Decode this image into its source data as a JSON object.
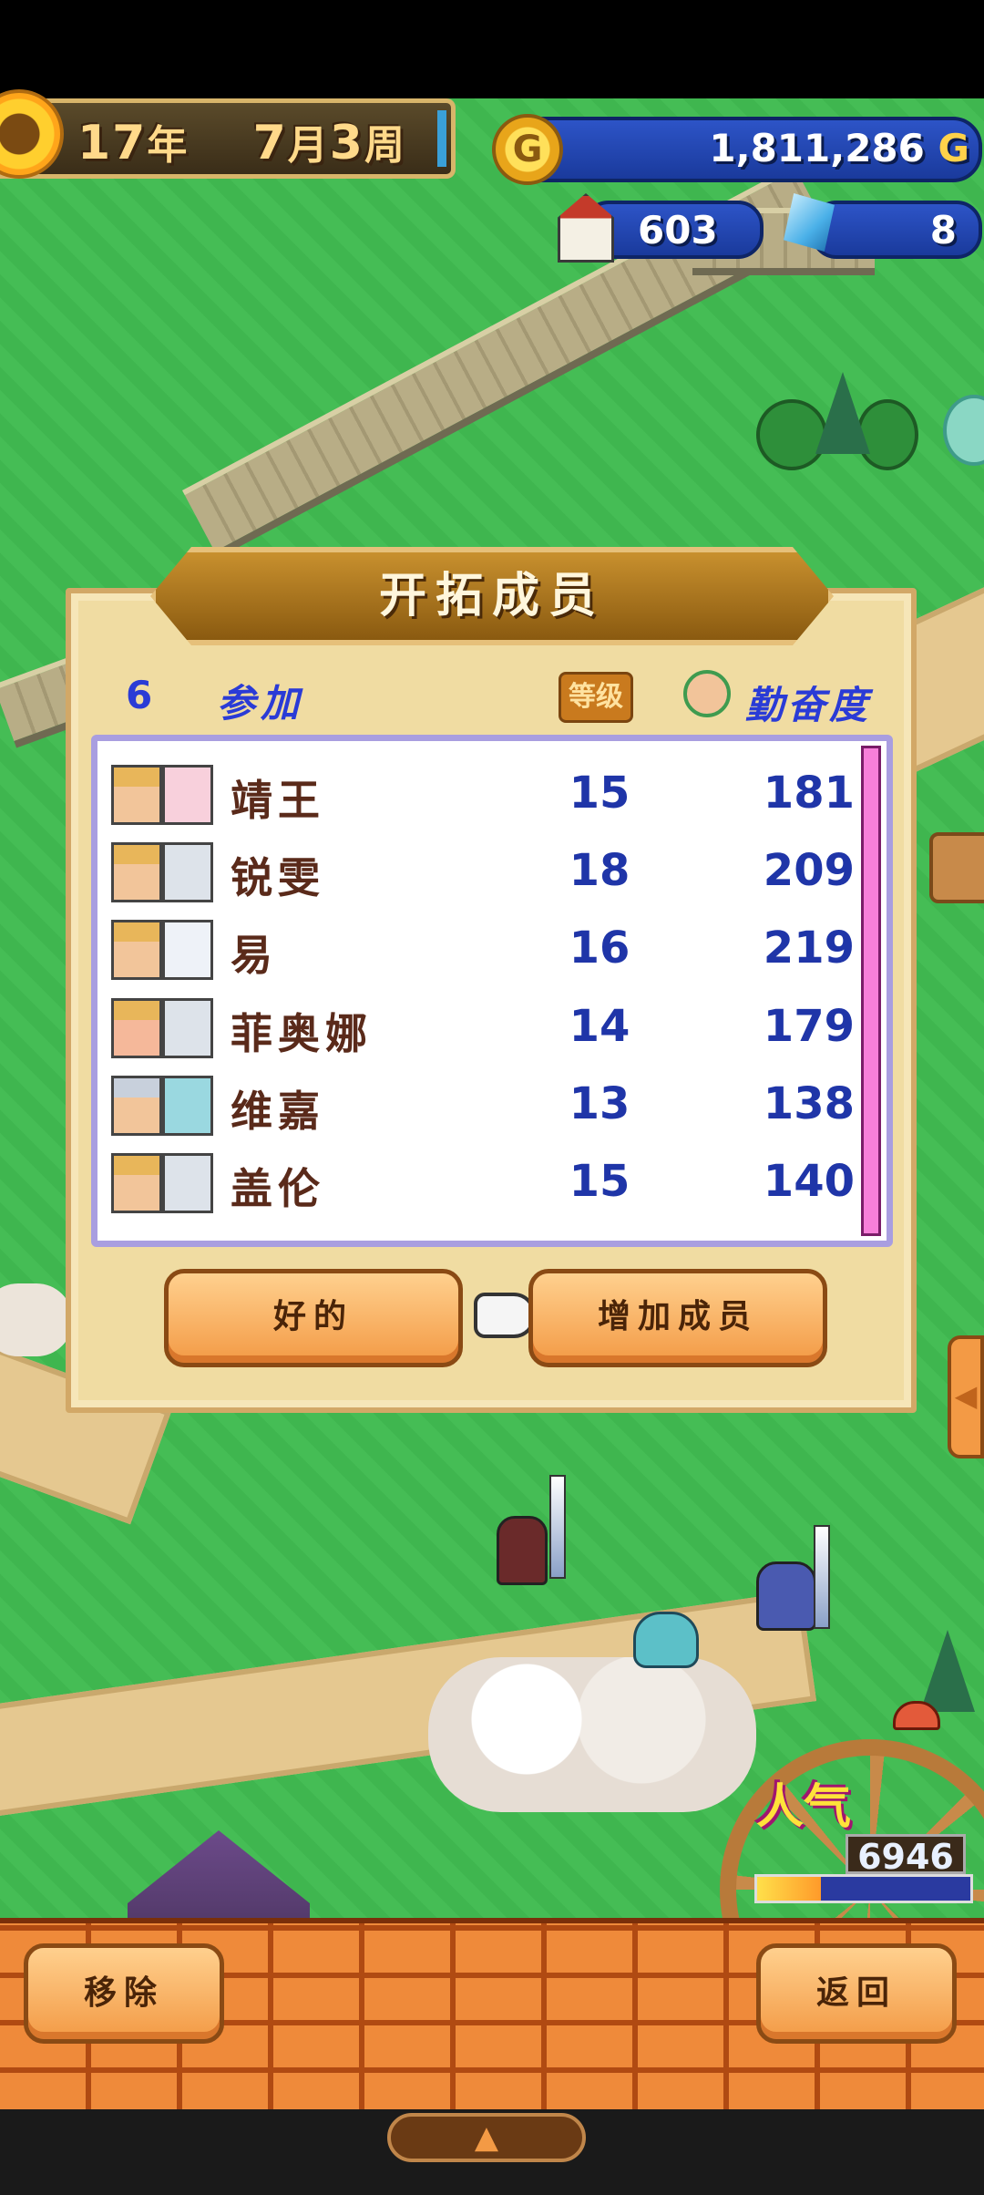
{
  "hud": {
    "date": {
      "year": "17",
      "year_unit": "年",
      "month": "7",
      "month_unit": "月",
      "week": "3",
      "week_unit": "周"
    },
    "gold": "1,811,286",
    "gold_unit": "G",
    "gold_icon_letter": "G",
    "population": "603",
    "gems": "8",
    "icons": [
      "sun-icon",
      "gold-coin-icon",
      "house-icon",
      "crystal-icon"
    ]
  },
  "dialog": {
    "title": "开拓成员",
    "member_count": "6",
    "join_label": "参加",
    "grade_label": "等级",
    "effort_label": "勤奋度",
    "members": [
      {
        "name": "靖王",
        "level": "15",
        "effort": "181"
      },
      {
        "name": "锐雯",
        "level": "18",
        "effort": "209"
      },
      {
        "name": "易",
        "level": "16",
        "effort": "219"
      },
      {
        "name": "菲奥娜",
        "level": "14",
        "effort": "179"
      },
      {
        "name": "维嘉",
        "level": "13",
        "effort": "138"
      },
      {
        "name": "盖伦",
        "level": "15",
        "effort": "140"
      }
    ],
    "ok_button": "好的",
    "add_member_button": "增加成员"
  },
  "popularity": {
    "label": "人气",
    "value": "6946",
    "level_fraction": 0.3
  },
  "bottom": {
    "remove_button": "移除",
    "back_button": "返回",
    "side_tab_icon": "◀",
    "expand_icon": "▲"
  },
  "colors": {
    "grass": "#45bd55",
    "panel_blue": "#1a3a9c",
    "dialog_bg": "#f0dca2",
    "button_orange": "#f39a45",
    "number_blue": "#1f35a8"
  }
}
